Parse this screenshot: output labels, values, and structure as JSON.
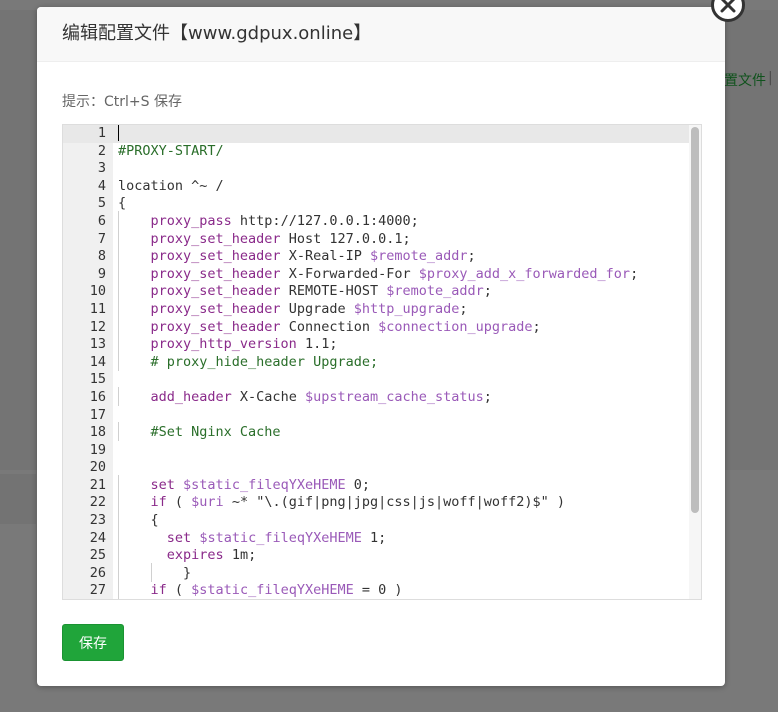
{
  "background": {
    "link_text": "置文件",
    "separator": "|"
  },
  "modal": {
    "title": "编辑配置文件【www.gdpux.online】",
    "hint": "提示：Ctrl+S 保存",
    "save_label": "保存",
    "close_icon": "close-icon"
  },
  "editor": {
    "lines": [
      {
        "n": "1",
        "text": ""
      },
      {
        "n": "2",
        "text": "#PROXY-START/"
      },
      {
        "n": "3",
        "text": ""
      },
      {
        "n": "4",
        "text": "location ^~ /"
      },
      {
        "n": "5",
        "text": "{"
      },
      {
        "n": "6",
        "text": "    proxy_pass http://127.0.0.1:4000;"
      },
      {
        "n": "7",
        "text": "    proxy_set_header Host 127.0.0.1;"
      },
      {
        "n": "8",
        "text": "    proxy_set_header X-Real-IP $remote_addr;"
      },
      {
        "n": "9",
        "text": "    proxy_set_header X-Forwarded-For $proxy_add_x_forwarded_for;"
      },
      {
        "n": "10",
        "text": "    proxy_set_header REMOTE-HOST $remote_addr;"
      },
      {
        "n": "11",
        "text": "    proxy_set_header Upgrade $http_upgrade;"
      },
      {
        "n": "12",
        "text": "    proxy_set_header Connection $connection_upgrade;"
      },
      {
        "n": "13",
        "text": "    proxy_http_version 1.1;"
      },
      {
        "n": "14",
        "text": "    # proxy_hide_header Upgrade;"
      },
      {
        "n": "15",
        "text": ""
      },
      {
        "n": "16",
        "text": "    add_header X-Cache $upstream_cache_status;"
      },
      {
        "n": "17",
        "text": ""
      },
      {
        "n": "18",
        "text": "    #Set Nginx Cache"
      },
      {
        "n": "19",
        "text": ""
      },
      {
        "n": "20",
        "text": ""
      },
      {
        "n": "21",
        "text": "    set $static_fileqYXeHEME 0;"
      },
      {
        "n": "22",
        "text": "    if ( $uri ~* \"\\.(gif|png|jpg|css|js|woff|woff2)$\" )"
      },
      {
        "n": "23",
        "text": "    {"
      },
      {
        "n": "24",
        "text": "      set $static_fileqYXeHEME 1;"
      },
      {
        "n": "25",
        "text": "      expires 1m;"
      },
      {
        "n": "26",
        "text": "        }"
      },
      {
        "n": "27",
        "text": "    if ( $static_fileqYXeHEME = 0 )"
      }
    ]
  },
  "colors": {
    "accent": "#20a53a",
    "keyword": "#8a2a8a",
    "variable": "#9a5ab8",
    "comment": "#2a6e2a"
  }
}
